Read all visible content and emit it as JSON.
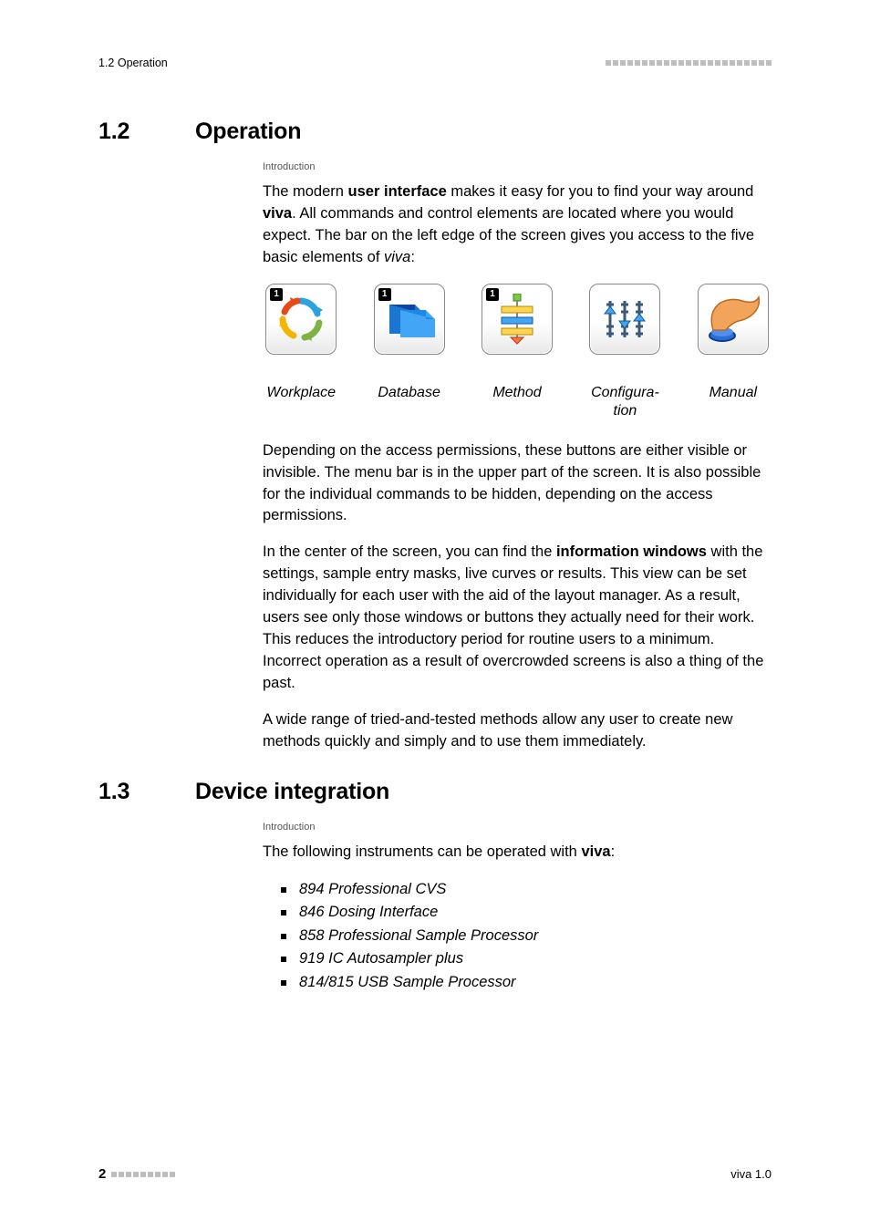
{
  "header": {
    "left": "1.2 Operation"
  },
  "sec12": {
    "num": "1.2",
    "title": "Operation",
    "intro_label": "Introduction",
    "para1_a": "The modern ",
    "para1_b": "user interface",
    "para1_c": " makes it easy for you to find your way around ",
    "para1_d": "viva",
    "para1_e": ". All commands and control elements are located where you would expect. The bar on the left edge of the screen gives you access to the five basic elements of ",
    "para1_f": "viva",
    "para1_g": ":",
    "icons": {
      "workplace": "Workplace",
      "database": "Database",
      "method": "Method",
      "configuration": "Configura-\ntion",
      "manual": "Manual"
    },
    "para2": "Depending on the access permissions, these buttons are either visible or invisible. The menu bar is in the upper part of the screen. It is also possible for the individual commands to be hidden, depending on the access permissions.",
    "para3_a": "In the center of the screen, you can find the ",
    "para3_b": "information windows",
    "para3_c": " with the settings, sample entry masks, live curves or results. This view can be set individually for each user with the aid of the layout manager. As a result, users see only those windows or buttons they actually need for their work. This reduces the introductory period for routine users to a minimum. Incorrect operation as a result of overcrowded screens is also a thing of the past.",
    "para4": "A wide range of tried-and-tested methods allow any user to create new methods quickly and simply and to use them immediately."
  },
  "sec13": {
    "num": "1.3",
    "title": "Device integration",
    "intro_label": "Introduction",
    "para1_a": "The following instruments can be operated with ",
    "para1_b": "viva",
    "para1_c": ":",
    "items": [
      "894 Professional CVS",
      "846 Dosing Interface",
      "858 Professional Sample Processor",
      "919 IC Autosampler plus",
      "814/815 USB Sample Processor"
    ]
  },
  "footer": {
    "page": "2",
    "right": "viva 1.0"
  }
}
